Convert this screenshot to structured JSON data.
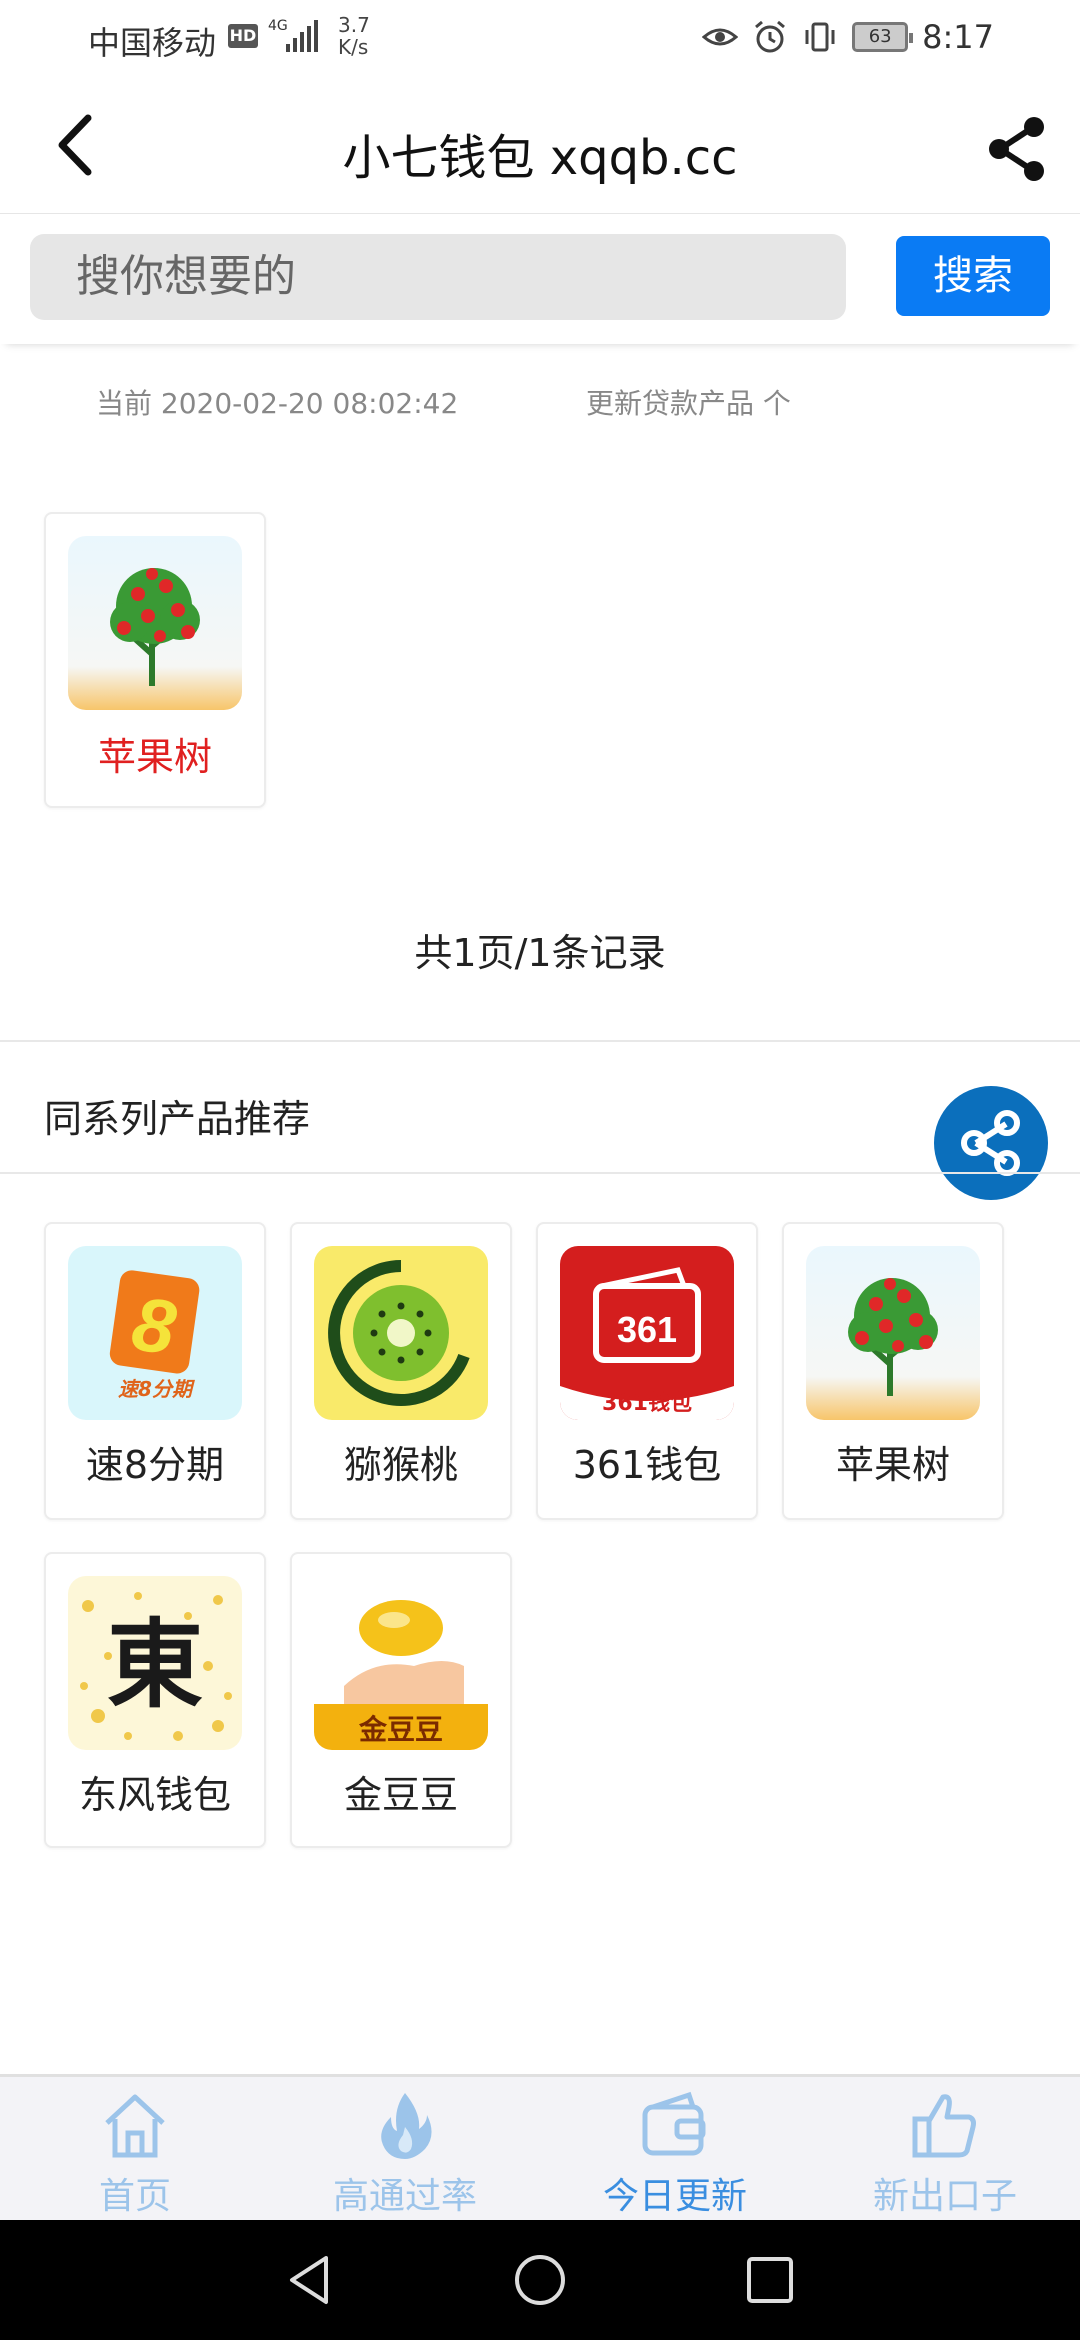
{
  "status_bar": {
    "carrier": "中国移动",
    "hd": "HD",
    "network": "4G",
    "speed_value": "3.7",
    "speed_unit": "K/s",
    "battery": "63",
    "time": "8:17"
  },
  "header": {
    "title": "小七钱包 xqqb.cc",
    "back_icon": "chevron-left-icon",
    "share_icon": "share-icon"
  },
  "search": {
    "placeholder": "搜你想要的",
    "button_label": "搜索"
  },
  "info": {
    "current": "当前 2020-02-20 08:02:42",
    "updated": "更新贷款产品 个"
  },
  "results": [
    {
      "name": "苹果树",
      "icon": "apple-tree-icon",
      "highlight_color": "#e02020"
    }
  ],
  "pager": "共1页/1条记录",
  "recommend": {
    "title": "同系列产品推荐",
    "items": [
      {
        "name": "速8分期",
        "icon": "su8-icon",
        "icon_text": "8",
        "icon_sub": "速8分期"
      },
      {
        "name": "猕猴桃",
        "icon": "kiwi-icon"
      },
      {
        "name": "361钱包",
        "icon": "wallet-361-icon",
        "icon_text": "361",
        "icon_sub": "361钱包"
      },
      {
        "name": "苹果树",
        "icon": "apple-tree-icon"
      },
      {
        "name": "东风钱包",
        "icon": "dongfeng-icon",
        "icon_text": "東"
      },
      {
        "name": "金豆豆",
        "icon": "gold-bean-icon",
        "icon_sub": "金豆豆"
      }
    ]
  },
  "bottom_nav": [
    {
      "label": "首页",
      "icon": "home-icon",
      "active": false
    },
    {
      "label": "高通过率",
      "icon": "flame-icon",
      "active": false
    },
    {
      "label": "今日更新",
      "icon": "wallet-icon",
      "active": true
    },
    {
      "label": "新出口子",
      "icon": "thumbs-up-icon",
      "active": false
    }
  ],
  "colors": {
    "accent": "#0a7bf4",
    "fab": "#0b6fbc",
    "nav_inactive": "#9cc4ea",
    "nav_active": "#3a8ee0"
  }
}
